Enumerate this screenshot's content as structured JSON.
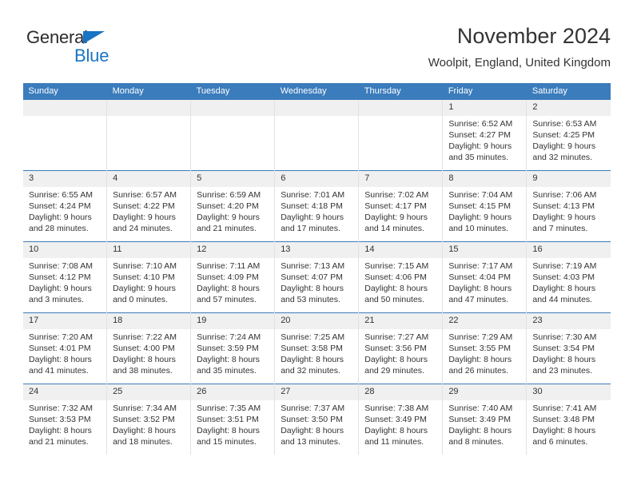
{
  "logo": {
    "line1": "General",
    "line2": "Blue",
    "triangle_color": "#1874c4",
    "text_color": "#2b2b2b"
  },
  "header": {
    "title": "November 2024",
    "subtitle": "Woolpit, England, United Kingdom"
  },
  "theme": {
    "header_blue": "#3b7cbc",
    "daynum_band": "#f0f0f0",
    "text": "#333333",
    "cell_divider": "#e2e2e2"
  },
  "weekdays": [
    "Sunday",
    "Monday",
    "Tuesday",
    "Wednesday",
    "Thursday",
    "Friday",
    "Saturday"
  ],
  "weeks": [
    [
      {
        "day": "",
        "lines": []
      },
      {
        "day": "",
        "lines": []
      },
      {
        "day": "",
        "lines": []
      },
      {
        "day": "",
        "lines": []
      },
      {
        "day": "",
        "lines": []
      },
      {
        "day": "1",
        "lines": [
          "Sunrise: 6:52 AM",
          "Sunset: 4:27 PM",
          "Daylight: 9 hours",
          "and 35 minutes."
        ]
      },
      {
        "day": "2",
        "lines": [
          "Sunrise: 6:53 AM",
          "Sunset: 4:25 PM",
          "Daylight: 9 hours",
          "and 32 minutes."
        ]
      }
    ],
    [
      {
        "day": "3",
        "lines": [
          "Sunrise: 6:55 AM",
          "Sunset: 4:24 PM",
          "Daylight: 9 hours",
          "and 28 minutes."
        ]
      },
      {
        "day": "4",
        "lines": [
          "Sunrise: 6:57 AM",
          "Sunset: 4:22 PM",
          "Daylight: 9 hours",
          "and 24 minutes."
        ]
      },
      {
        "day": "5",
        "lines": [
          "Sunrise: 6:59 AM",
          "Sunset: 4:20 PM",
          "Daylight: 9 hours",
          "and 21 minutes."
        ]
      },
      {
        "day": "6",
        "lines": [
          "Sunrise: 7:01 AM",
          "Sunset: 4:18 PM",
          "Daylight: 9 hours",
          "and 17 minutes."
        ]
      },
      {
        "day": "7",
        "lines": [
          "Sunrise: 7:02 AM",
          "Sunset: 4:17 PM",
          "Daylight: 9 hours",
          "and 14 minutes."
        ]
      },
      {
        "day": "8",
        "lines": [
          "Sunrise: 7:04 AM",
          "Sunset: 4:15 PM",
          "Daylight: 9 hours",
          "and 10 minutes."
        ]
      },
      {
        "day": "9",
        "lines": [
          "Sunrise: 7:06 AM",
          "Sunset: 4:13 PM",
          "Daylight: 9 hours",
          "and 7 minutes."
        ]
      }
    ],
    [
      {
        "day": "10",
        "lines": [
          "Sunrise: 7:08 AM",
          "Sunset: 4:12 PM",
          "Daylight: 9 hours",
          "and 3 minutes."
        ]
      },
      {
        "day": "11",
        "lines": [
          "Sunrise: 7:10 AM",
          "Sunset: 4:10 PM",
          "Daylight: 9 hours",
          "and 0 minutes."
        ]
      },
      {
        "day": "12",
        "lines": [
          "Sunrise: 7:11 AM",
          "Sunset: 4:09 PM",
          "Daylight: 8 hours",
          "and 57 minutes."
        ]
      },
      {
        "day": "13",
        "lines": [
          "Sunrise: 7:13 AM",
          "Sunset: 4:07 PM",
          "Daylight: 8 hours",
          "and 53 minutes."
        ]
      },
      {
        "day": "14",
        "lines": [
          "Sunrise: 7:15 AM",
          "Sunset: 4:06 PM",
          "Daylight: 8 hours",
          "and 50 minutes."
        ]
      },
      {
        "day": "15",
        "lines": [
          "Sunrise: 7:17 AM",
          "Sunset: 4:04 PM",
          "Daylight: 8 hours",
          "and 47 minutes."
        ]
      },
      {
        "day": "16",
        "lines": [
          "Sunrise: 7:19 AM",
          "Sunset: 4:03 PM",
          "Daylight: 8 hours",
          "and 44 minutes."
        ]
      }
    ],
    [
      {
        "day": "17",
        "lines": [
          "Sunrise: 7:20 AM",
          "Sunset: 4:01 PM",
          "Daylight: 8 hours",
          "and 41 minutes."
        ]
      },
      {
        "day": "18",
        "lines": [
          "Sunrise: 7:22 AM",
          "Sunset: 4:00 PM",
          "Daylight: 8 hours",
          "and 38 minutes."
        ]
      },
      {
        "day": "19",
        "lines": [
          "Sunrise: 7:24 AM",
          "Sunset: 3:59 PM",
          "Daylight: 8 hours",
          "and 35 minutes."
        ]
      },
      {
        "day": "20",
        "lines": [
          "Sunrise: 7:25 AM",
          "Sunset: 3:58 PM",
          "Daylight: 8 hours",
          "and 32 minutes."
        ]
      },
      {
        "day": "21",
        "lines": [
          "Sunrise: 7:27 AM",
          "Sunset: 3:56 PM",
          "Daylight: 8 hours",
          "and 29 minutes."
        ]
      },
      {
        "day": "22",
        "lines": [
          "Sunrise: 7:29 AM",
          "Sunset: 3:55 PM",
          "Daylight: 8 hours",
          "and 26 minutes."
        ]
      },
      {
        "day": "23",
        "lines": [
          "Sunrise: 7:30 AM",
          "Sunset: 3:54 PM",
          "Daylight: 8 hours",
          "and 23 minutes."
        ]
      }
    ],
    [
      {
        "day": "24",
        "lines": [
          "Sunrise: 7:32 AM",
          "Sunset: 3:53 PM",
          "Daylight: 8 hours",
          "and 21 minutes."
        ]
      },
      {
        "day": "25",
        "lines": [
          "Sunrise: 7:34 AM",
          "Sunset: 3:52 PM",
          "Daylight: 8 hours",
          "and 18 minutes."
        ]
      },
      {
        "day": "26",
        "lines": [
          "Sunrise: 7:35 AM",
          "Sunset: 3:51 PM",
          "Daylight: 8 hours",
          "and 15 minutes."
        ]
      },
      {
        "day": "27",
        "lines": [
          "Sunrise: 7:37 AM",
          "Sunset: 3:50 PM",
          "Daylight: 8 hours",
          "and 13 minutes."
        ]
      },
      {
        "day": "28",
        "lines": [
          "Sunrise: 7:38 AM",
          "Sunset: 3:49 PM",
          "Daylight: 8 hours",
          "and 11 minutes."
        ]
      },
      {
        "day": "29",
        "lines": [
          "Sunrise: 7:40 AM",
          "Sunset: 3:49 PM",
          "Daylight: 8 hours",
          "and 8 minutes."
        ]
      },
      {
        "day": "30",
        "lines": [
          "Sunrise: 7:41 AM",
          "Sunset: 3:48 PM",
          "Daylight: 8 hours",
          "and 6 minutes."
        ]
      }
    ]
  ]
}
